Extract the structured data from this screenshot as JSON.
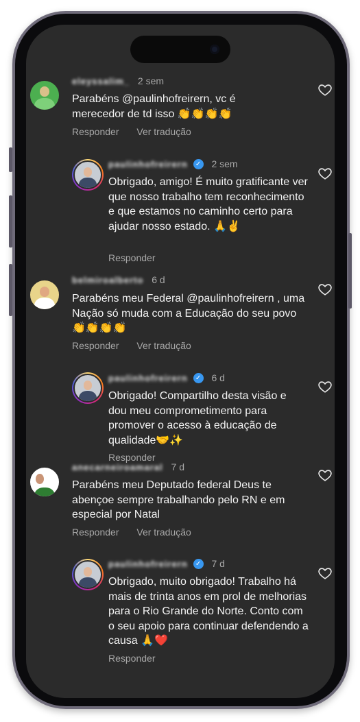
{
  "comments": [
    {
      "username": "eleyssalim_",
      "time": "2 sem",
      "verified": false,
      "text": "Parabéns @paulinhofreirern, vc é merecedor de td isso 👏👏👏👏",
      "reply": "Responder",
      "translate": "Ver tradução"
    },
    {
      "username": "paulinhofreirern",
      "time": "2 sem",
      "verified": true,
      "text": "Obrigado, amigo! É muito gratificante ver que nosso trabalho tem reconhecimento e que estamos no caminho certo para ajudar nosso estado. 🙏✌️",
      "reply": "Responder"
    },
    {
      "username": "belmiroalberto",
      "time": "6 d",
      "verified": false,
      "text": "Parabéns meu Federal @paulinhofreirern , uma Nação só muda com a Educação do seu povo 👏👏👏👏",
      "reply": "Responder",
      "translate": "Ver tradução"
    },
    {
      "username": "paulinhofreirern",
      "time": "6 d",
      "verified": true,
      "text": "Obrigado! Compartilho desta visão e dou meu comprometimento para promover o acesso à educação de qualidade🤝✨",
      "reply": "Responder"
    },
    {
      "username": "anecarneiroamaral",
      "time": "7 d",
      "verified": false,
      "text": "Parabéns meu Deputado federal Deus te abençoe sempre trabalhando pelo RN e em especial por Natal",
      "reply": "Responder",
      "translate": "Ver tradução"
    },
    {
      "username": "paulinhofreirern",
      "time": "7 d",
      "verified": true,
      "text": "Obrigado, muito obrigado! Trabalho há mais de trinta anos em prol de melhorias para o Rio Grande do Norte. Conto com o seu apoio para continuar defendendo a causa 🙏❤️",
      "reply": "Responder"
    }
  ],
  "icons": {
    "heart": "heart-outline-icon",
    "verified": "verified-badge-icon"
  },
  "colors": {
    "screen_bg": "#2b2b2b",
    "text": "#f2f2f2",
    "muted": "#a8a8a8",
    "verified": "#3897f0"
  }
}
